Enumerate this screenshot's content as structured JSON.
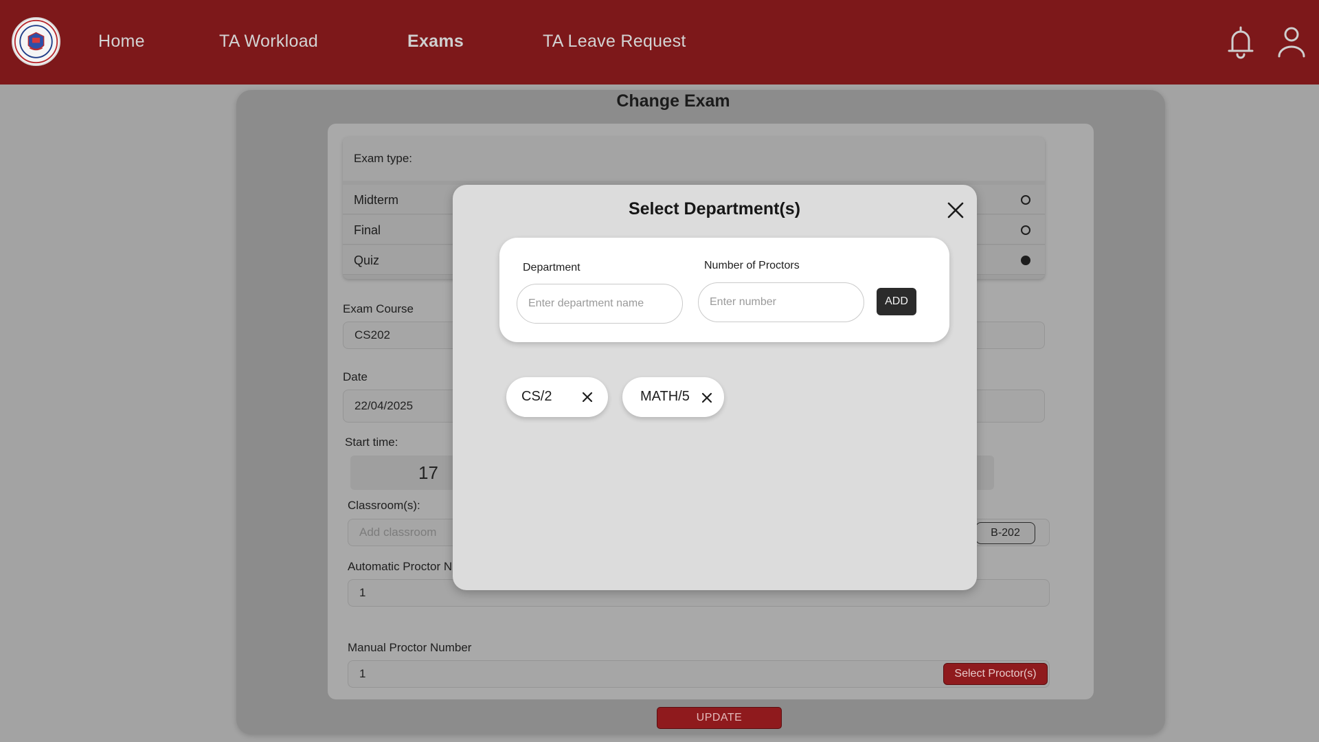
{
  "nav": {
    "items": [
      {
        "label": "Home",
        "active": false
      },
      {
        "label": "TA Workload",
        "active": false
      },
      {
        "label": "Exams",
        "active": true
      },
      {
        "label": "TA Leave Request",
        "active": false
      }
    ],
    "icons": [
      "bell-icon",
      "user-icon"
    ]
  },
  "page": {
    "title": "Change Exam"
  },
  "form": {
    "exam_type_label": "Exam type:",
    "exam_types": [
      {
        "label": "Midterm",
        "selected": false
      },
      {
        "label": "Final",
        "selected": false
      },
      {
        "label": "Quiz",
        "selected": true
      }
    ],
    "course_label": "Exam Course",
    "course_value": "CS202",
    "date_label": "Date",
    "date_value": "22/04/2025",
    "start_time_label": "Start time:",
    "start_time_value": "17",
    "classroom_label": "Classroom(s):",
    "classroom_placeholder": "Add classroom",
    "classroom_chip": "B-202",
    "auto_proctor_label": "Automatic Proctor N",
    "auto_proctor_value": "1",
    "manual_proctor_label": "Manual Proctor Number",
    "manual_proctor_value": "1",
    "select_proctor_button": "Select Proctor(s)",
    "update_button": "UPDATE"
  },
  "modal": {
    "title": "Select Department(s)",
    "department_label": "Department",
    "department_placeholder": "Enter department name",
    "proctors_label": "Number of Proctors",
    "proctors_placeholder": "Enter number",
    "add_button": "ADD",
    "chips": [
      {
        "text": "CS/2"
      },
      {
        "text": "MATH/5"
      }
    ]
  },
  "colors": {
    "topbar": "#7d181a",
    "accent_button": "#8f1a1d",
    "modal_bg": "#dcdcdc",
    "overlay_bg": "#a3a3a3"
  }
}
